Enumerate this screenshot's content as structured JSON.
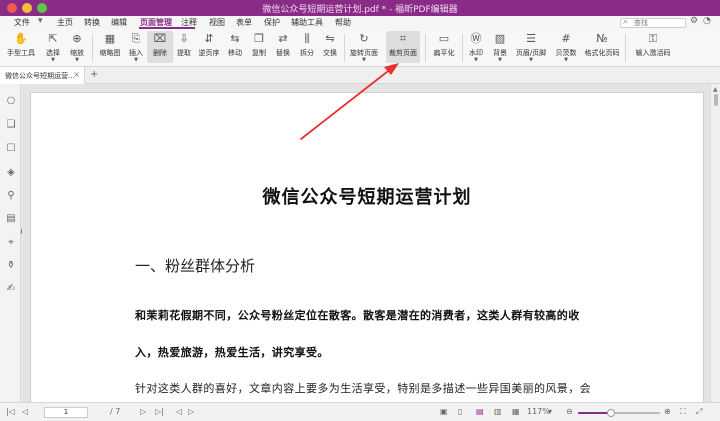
{
  "window": {
    "title": "微信公众号短期运营计划.pdf * - 福昕PDF编辑器"
  },
  "menubar": {
    "items": [
      "文件",
      "主页",
      "转换",
      "编辑",
      "页面管理",
      "注释",
      "视图",
      "表单",
      "保护",
      "辅助工具",
      "帮助"
    ],
    "active": "页面管理",
    "search_placeholder": "查找"
  },
  "toolbar": {
    "tools": [
      {
        "label": "手型工具",
        "icon": "✋"
      },
      {
        "label": "选择",
        "icon": "⇱"
      },
      {
        "label": "缩放",
        "icon": "⊕"
      },
      {
        "label": "缩略图",
        "icon": "▦"
      },
      {
        "label": "插入",
        "icon": "⎘"
      },
      {
        "label": "删除",
        "icon": "⌧"
      },
      {
        "label": "提取",
        "icon": "⇩"
      },
      {
        "label": "逆页序",
        "icon": "⇵"
      },
      {
        "label": "移动",
        "icon": "⇆"
      },
      {
        "label": "复制",
        "icon": "❐"
      },
      {
        "label": "替换",
        "icon": "⇄"
      },
      {
        "label": "拆分",
        "icon": "⫼"
      },
      {
        "label": "交换",
        "icon": "⇋"
      },
      {
        "label": "旋转页面",
        "icon": "↻"
      },
      {
        "label": "裁剪页面",
        "icon": "⌗"
      },
      {
        "label": "扁平化",
        "icon": "▭"
      },
      {
        "label": "水印",
        "icon": "Ⓦ"
      },
      {
        "label": "背景",
        "icon": "▨"
      },
      {
        "label": "页眉/页脚",
        "icon": "☰"
      },
      {
        "label": "贝茨数",
        "icon": "#"
      },
      {
        "label": "格式化页码",
        "icon": "№"
      },
      {
        "label": "输入激活码",
        "icon": "⚿"
      }
    ]
  },
  "tabs": [
    {
      "label": "微信公众号短期运营...",
      "close": "×"
    }
  ],
  "tab_add": "+",
  "document": {
    "title": "微信公众号短期运营计划",
    "section_heading": "一、粉丝群体分析",
    "para_bold_1": "和茉莉花假期不同，公众号粉丝定位在散客。散客是潜在的消费者，这类人群有较高的收",
    "para_bold_2": "入，热爱旅游，热爱生活，讲究享受。",
    "para_3": "针对这类人群的喜好，文章内容上要多为生活享受，特别是多描述一些异国美丽的风景，会"
  },
  "statusbar": {
    "current_page": "1",
    "total_pages": "/ 7",
    "zoom": "117%",
    "zoom_fraction": 0.4
  },
  "annotation": {
    "color": "#e8312f"
  },
  "colors": {
    "accent": "#8a2b88"
  }
}
